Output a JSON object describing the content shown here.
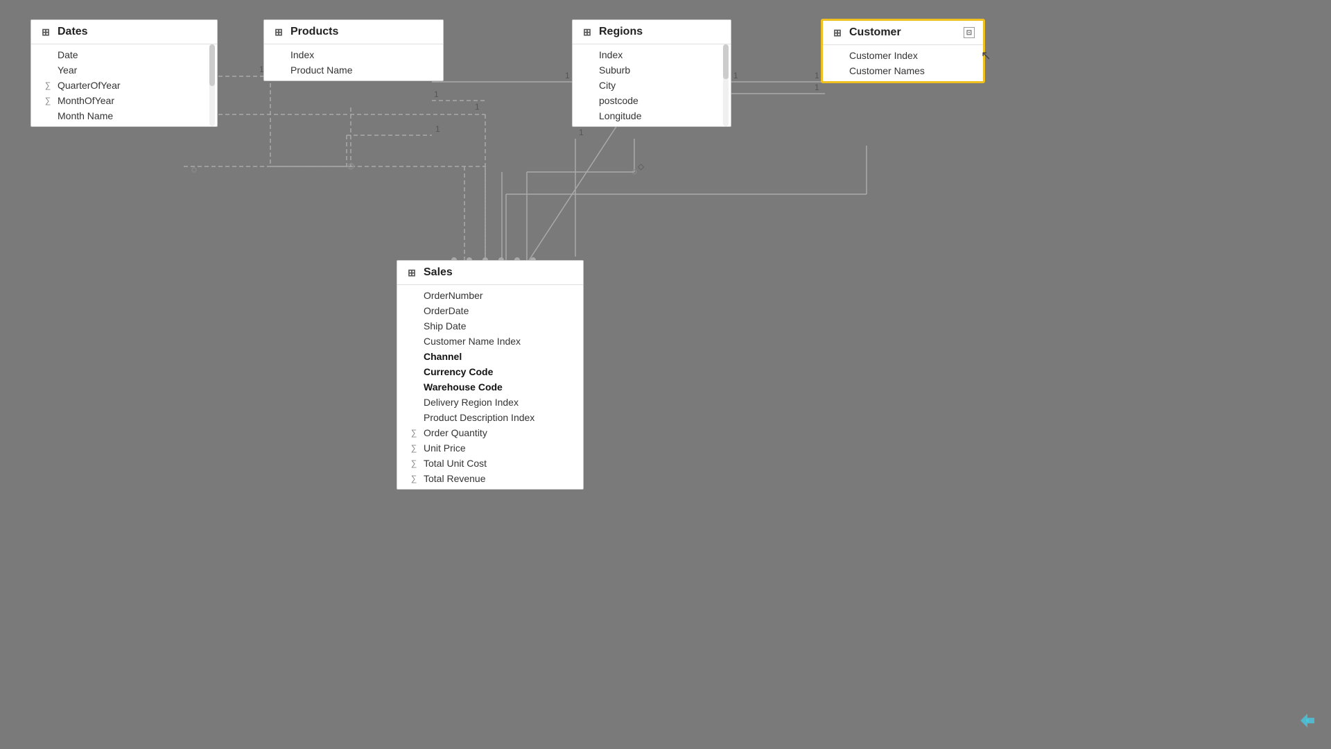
{
  "colors": {
    "bg": "#7a7a7a",
    "card_bg": "#ffffff",
    "card_border": "#cccccc",
    "selected_border": "#f0c020",
    "header_text": "#222222",
    "field_text": "#333333",
    "bold_field": "#111111",
    "icon_color": "#888888",
    "sigma_color": "#888888"
  },
  "tables": {
    "dates": {
      "title": "Dates",
      "fields": [
        {
          "name": "Date",
          "type": "plain",
          "bold": false
        },
        {
          "name": "Year",
          "type": "plain",
          "bold": false
        },
        {
          "name": "QuarterOfYear",
          "type": "sigma",
          "bold": false
        },
        {
          "name": "MonthOfYear",
          "type": "sigma",
          "bold": false
        },
        {
          "name": "Month Name",
          "type": "plain",
          "bold": false
        }
      ],
      "has_scroll": true
    },
    "products": {
      "title": "Products",
      "fields": [
        {
          "name": "Index",
          "type": "plain",
          "bold": false
        },
        {
          "name": "Product Name",
          "type": "plain",
          "bold": false
        }
      ],
      "has_scroll": false
    },
    "regions": {
      "title": "Regions",
      "fields": [
        {
          "name": "Index",
          "type": "plain",
          "bold": false
        },
        {
          "name": "Suburb",
          "type": "plain",
          "bold": false
        },
        {
          "name": "City",
          "type": "plain",
          "bold": false
        },
        {
          "name": "postcode",
          "type": "plain",
          "bold": false
        },
        {
          "name": "Longitude",
          "type": "plain",
          "bold": false
        }
      ],
      "has_scroll": true
    },
    "customer": {
      "title": "Customer",
      "fields": [
        {
          "name": "Customer Index",
          "type": "plain",
          "bold": false
        },
        {
          "name": "Customer Names",
          "type": "plain",
          "bold": false
        }
      ],
      "has_scroll": false,
      "selected": true,
      "has_expand": true
    },
    "sales": {
      "title": "Sales",
      "fields": [
        {
          "name": "OrderNumber",
          "type": "plain",
          "bold": false
        },
        {
          "name": "OrderDate",
          "type": "plain",
          "bold": false
        },
        {
          "name": "Ship Date",
          "type": "plain",
          "bold": false
        },
        {
          "name": "Customer Name Index",
          "type": "plain",
          "bold": false
        },
        {
          "name": "Channel",
          "type": "plain",
          "bold": true
        },
        {
          "name": "Currency Code",
          "type": "plain",
          "bold": true
        },
        {
          "name": "Warehouse Code",
          "type": "plain",
          "bold": true
        },
        {
          "name": "Delivery Region Index",
          "type": "plain",
          "bold": false
        },
        {
          "name": "Product Description Index",
          "type": "plain",
          "bold": false
        },
        {
          "name": "Order Quantity",
          "type": "sigma",
          "bold": false
        },
        {
          "name": "Unit Price",
          "type": "sigma",
          "bold": false
        },
        {
          "name": "Total Unit Cost",
          "type": "sigma",
          "bold": false
        },
        {
          "name": "Total Revenue",
          "type": "sigma",
          "bold": false
        }
      ],
      "has_scroll": false
    }
  },
  "relationship_labels": {
    "one": "1",
    "many": "*"
  }
}
